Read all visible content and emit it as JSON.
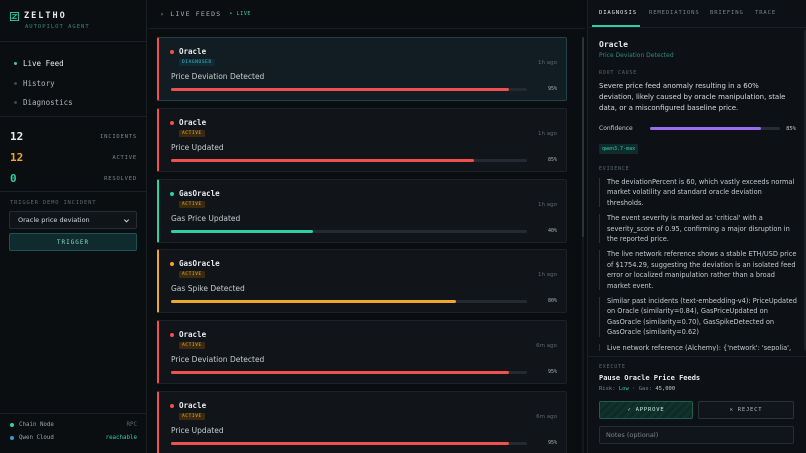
{
  "brand": {
    "name": "ZELTHO",
    "subtitle": "AUTOPILOT AGENT",
    "color": "#2fd1a3"
  },
  "nav": {
    "items": [
      {
        "label": "Live Feed",
        "active": true
      },
      {
        "label": "History",
        "active": false
      },
      {
        "label": "Diagnostics",
        "active": false
      }
    ]
  },
  "stats": [
    {
      "value": "12",
      "label": "INCIDENTS",
      "color": "#e8ecef"
    },
    {
      "value": "12",
      "label": "ACTIVE",
      "color": "#f0a72f"
    },
    {
      "value": "0",
      "label": "RESOLVED",
      "color": "#2fd1a3"
    }
  ],
  "trigger": {
    "title": "TRIGGER DEMO INCIDENT",
    "selected": "Oracle price deviation",
    "button": "TRIGGER"
  },
  "connections": [
    {
      "name": "Chain Node",
      "status": "RPC",
      "dot_color": "#2fd1a3",
      "status_color": "#5d676f"
    },
    {
      "name": "Qwen Cloud",
      "status": "reachable",
      "dot_color": "#2f9bd1",
      "status_color": "#2fd1a3"
    }
  ],
  "feed": {
    "title": "LIVE FEEDS",
    "live_label": "• LIVE"
  },
  "incidents": [
    {
      "name": "Oracle",
      "badge": "DIAGNOSED",
      "time": "1h ago",
      "desc": "Price Deviation Detected",
      "pct": 95,
      "pct_label": "95%",
      "sev_color": "#f0514f",
      "bar_color": "#f0514f",
      "accent": "#f0514f",
      "selected": true
    },
    {
      "name": "Oracle",
      "badge": "ACTIVE",
      "time": "1h ago",
      "desc": "Price Updated",
      "pct": 85,
      "pct_label": "85%",
      "sev_color": "#f0514f",
      "bar_color": "#f0514f",
      "accent": "#f0514f",
      "selected": false
    },
    {
      "name": "GasOracle",
      "badge": "ACTIVE",
      "time": "1h ago",
      "desc": "Gas Price Updated",
      "pct": 40,
      "pct_label": "40%",
      "sev_color": "#2fd1a3",
      "bar_color": "#2fd1a3",
      "accent": "#2fd1a3",
      "selected": false
    },
    {
      "name": "GasOracle",
      "badge": "ACTIVE",
      "time": "1h ago",
      "desc": "Gas Spike Detected",
      "pct": 80,
      "pct_label": "80%",
      "sev_color": "#f0a72f",
      "bar_color": "#f0a72f",
      "accent": "#f0a72f",
      "selected": false
    },
    {
      "name": "Oracle",
      "badge": "ACTIVE",
      "time": "6m ago",
      "desc": "Price Deviation Detected",
      "pct": 95,
      "pct_label": "95%",
      "sev_color": "#f0514f",
      "bar_color": "#f0514f",
      "accent": "#f0514f",
      "selected": false
    },
    {
      "name": "Oracle",
      "badge": "ACTIVE",
      "time": "6m ago",
      "desc": "Price Updated",
      "pct": 95,
      "pct_label": "95%",
      "sev_color": "#f0514f",
      "bar_color": "#f0514f",
      "accent": "#f0514f",
      "selected": false
    }
  ],
  "panel": {
    "tabs": [
      "DIAGNOSIS",
      "REMEDIATIONS",
      "BRIEFING",
      "TRACE"
    ],
    "title": "Oracle",
    "subtitle": "Price Deviation Detected",
    "root_cause_label": "ROOT CAUSE",
    "root_cause": "Severe price feed anomaly resulting in a 60% deviation, likely caused by oracle manipulation, stale data, or a misconfigured baseline price.",
    "confidence_label": "Confidence",
    "confidence": 85,
    "confidence_pct": "85%",
    "model": "qwen3.7-max",
    "evidence_label": "EVIDENCE",
    "evidence": [
      "The deviationPercent is 60, which vastly exceeds normal market volatility and standard oracle deviation thresholds.",
      "The event severity is marked as 'critical' with a severity_score of 0.95, confirming a major disruption in the reported price.",
      "The live network reference shows a stable ETH/USD price of $1754.29, suggesting the deviation is an isolated feed error or localized manipulation rather than a broad market event.",
      "Similar past incidents (text-embedding-v4): PriceUpdated on Oracle (similarity=0.84), GasPriceUpdated on GasOracle (similarity=0.70), GasSpikeDetected on GasOracle (similarity=0.62)",
      "Live network reference (Alchemy): {'network': 'sepolia', 'feed': 'Chainlink ETH/USD', 'price_usd': 1754.29, 'source': 'Alchemy'}"
    ],
    "execute_label": "EXECUTE",
    "action_title": "Pause Oracle Price Feeds",
    "risk_label": "Risk:",
    "risk_value": "Low",
    "gas_label": "Gas:",
    "gas_value": "45,000",
    "approve_label": "APPROVE",
    "reject_label": "REJECT",
    "notes_placeholder": "Notes (optional)"
  }
}
